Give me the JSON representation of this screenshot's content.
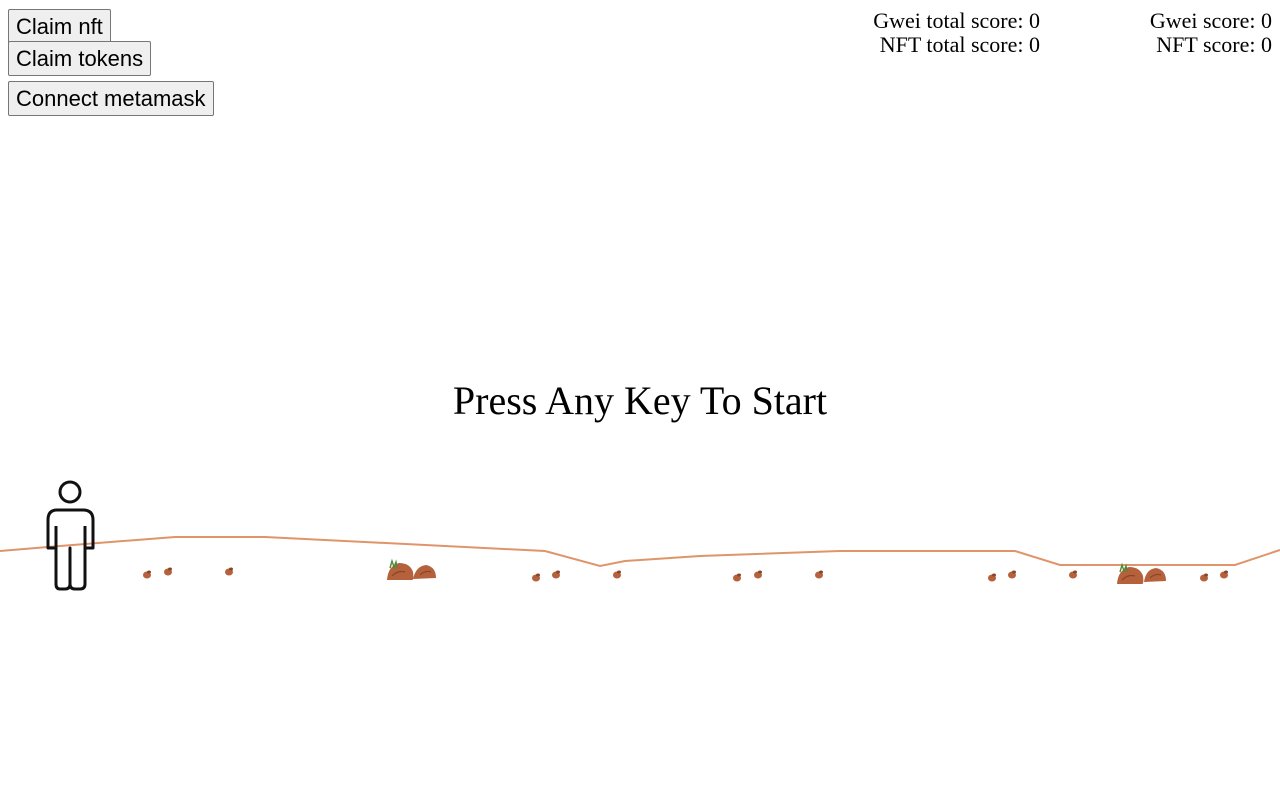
{
  "buttons": {
    "claim_nft": "Claim nft",
    "claim_tokens": "Claim tokens",
    "connect_metamask": "Connect metamask"
  },
  "scores": {
    "gwei_total_label": "Gwei total score: ",
    "gwei_total_value": "0",
    "nft_total_label": "NFT total score: ",
    "nft_total_value": "0",
    "gwei_label": "Gwei score: ",
    "gwei_value": "0",
    "nft_label": "NFT score: ",
    "nft_value": "0"
  },
  "game": {
    "prompt": "Press Any Key To Start"
  },
  "colors": {
    "ground_line": "#e0946a",
    "rock": "#b5613c",
    "rock_shadow": "#8a4428",
    "grass": "#4e8a3a",
    "player_stroke": "#111111"
  },
  "icons": {
    "player": "stick-figure-icon",
    "rock": "rock-icon",
    "pebble": "pebble-icon"
  }
}
